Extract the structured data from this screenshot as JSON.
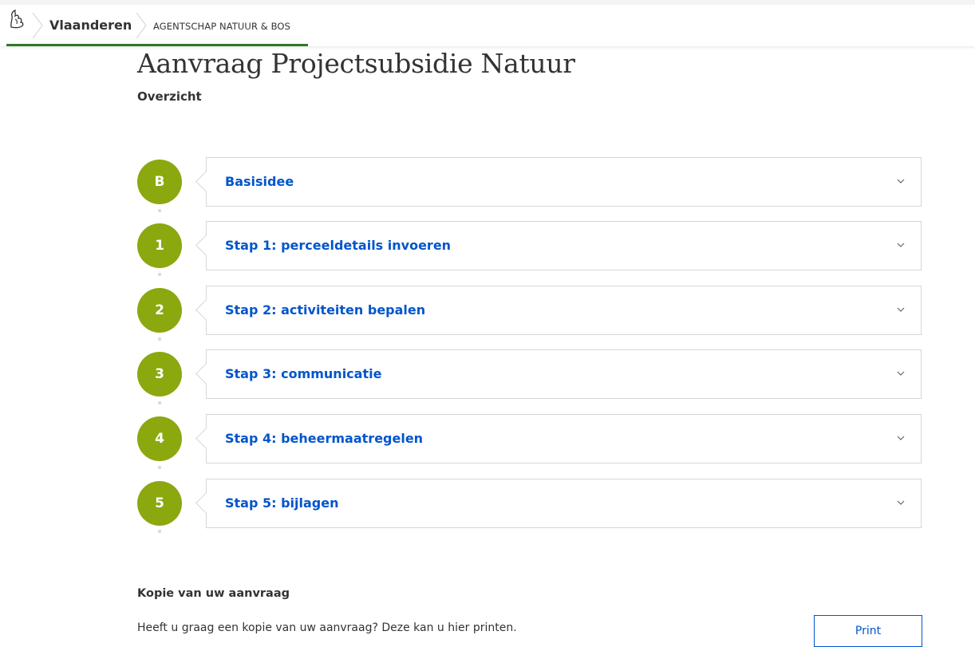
{
  "header": {
    "brand": "Vlaanderen",
    "agency": "AGENTSCHAP NATUUR & BOS",
    "brand_icon": "flemish-lion-icon"
  },
  "page": {
    "title": "Aanvraag Projectsubsidie Natuur",
    "subtitle": "Overzicht"
  },
  "steps": [
    {
      "badge": "B",
      "label": "Basisidee"
    },
    {
      "badge": "1",
      "label": "Stap 1: perceeldetails invoeren"
    },
    {
      "badge": "2",
      "label": "Stap 2: activiteiten bepalen"
    },
    {
      "badge": "3",
      "label": "Stap 3: communicatie"
    },
    {
      "badge": "4",
      "label": "Stap 4: beheermaatregelen"
    },
    {
      "badge": "5",
      "label": "Stap 5: bijlagen"
    }
  ],
  "copy": {
    "title": "Kopie van uw aanvraag",
    "text": "Heeft u graag een kopie van uw aanvraag? Deze kan u hier printen.",
    "print_label": "Print"
  },
  "colors": {
    "accent_green": "#8ba80f",
    "link_blue": "#0055cc",
    "header_green": "#2d7a25"
  }
}
